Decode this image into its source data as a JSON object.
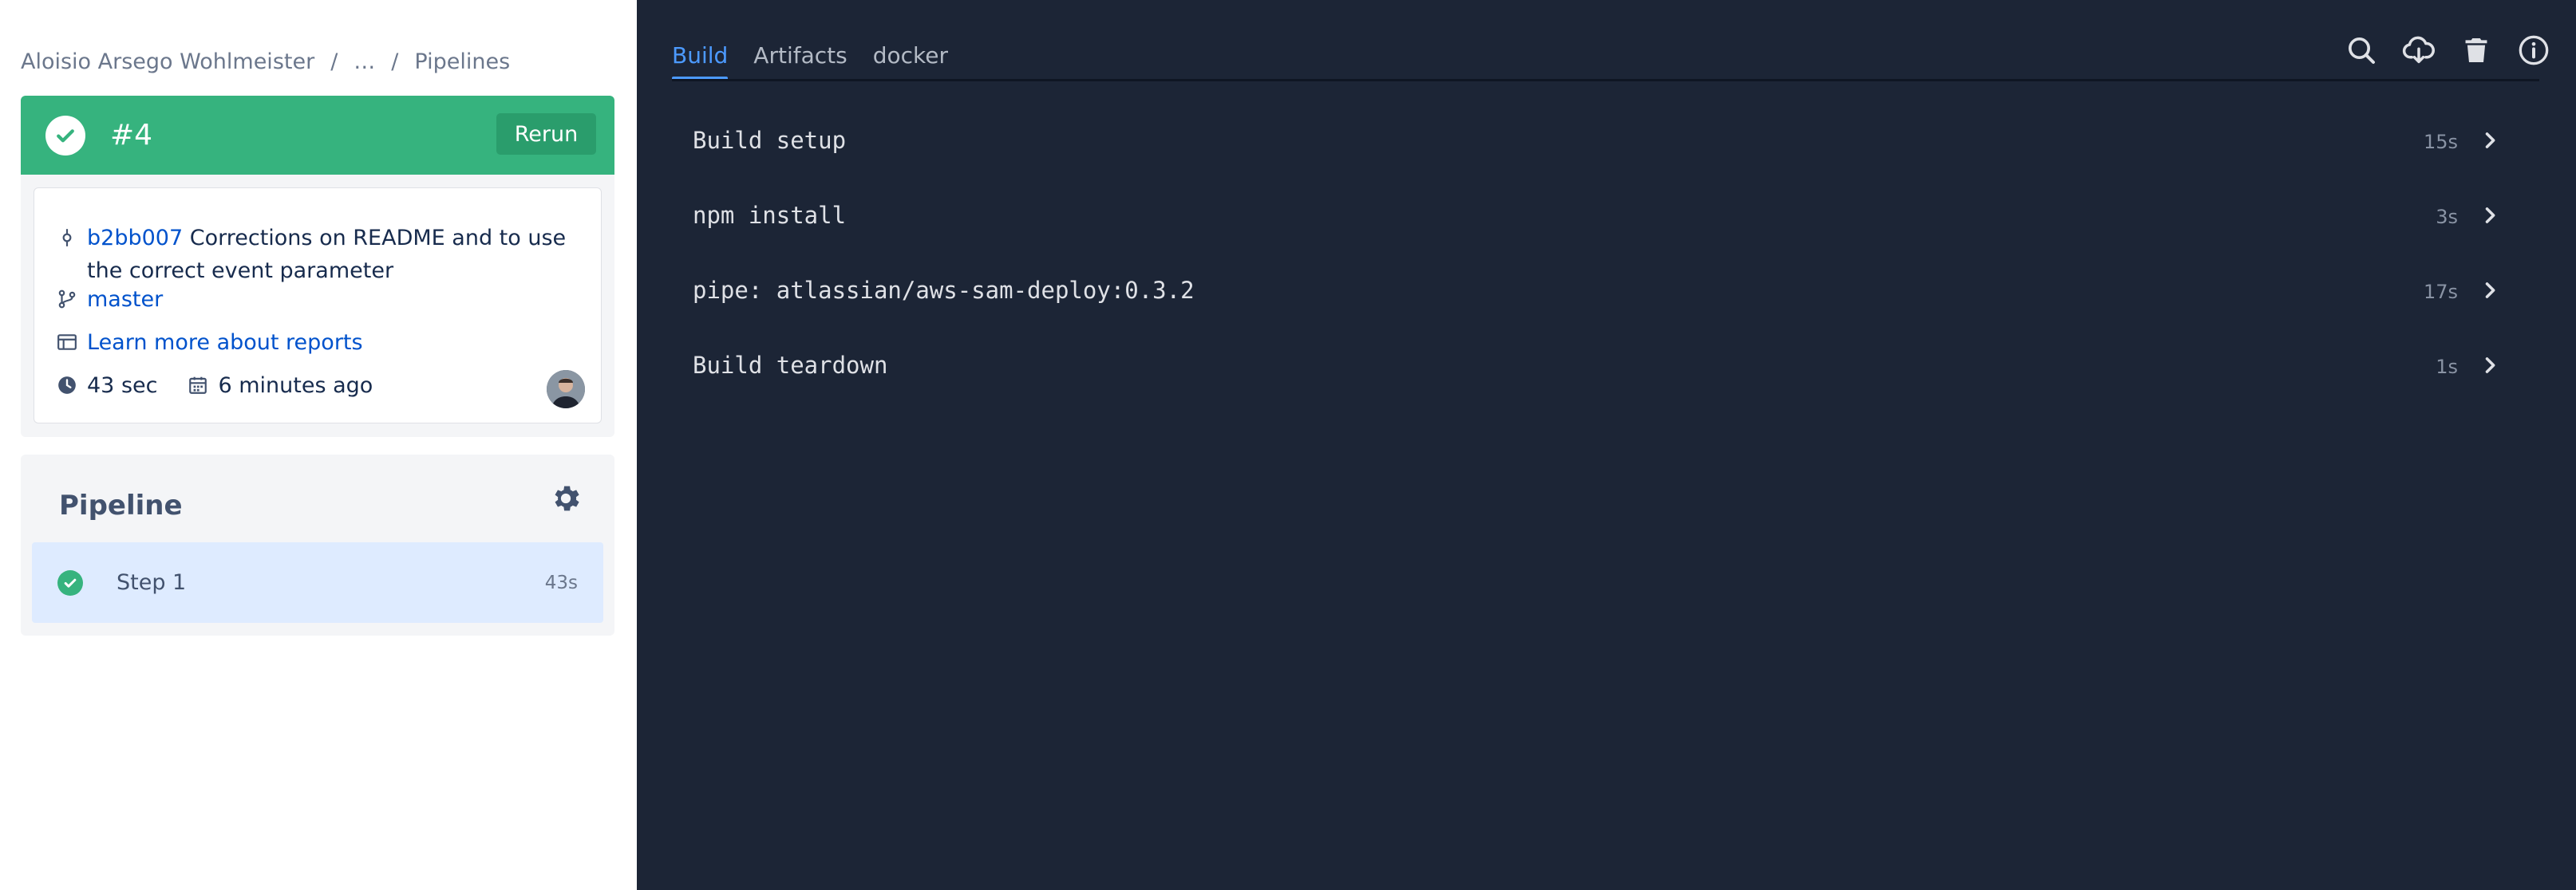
{
  "breadcrumb": {
    "items": [
      "Aloisio Arsego Wohlmeister",
      "…",
      "Pipelines"
    ],
    "separator": "/"
  },
  "build": {
    "number": "#4",
    "status": "successful",
    "status_color": "#36b37e",
    "rerun_label": "Rerun"
  },
  "commit": {
    "hash": "b2bb007",
    "message": "Corrections on README and to use the correct event parameter"
  },
  "branch": "master",
  "reports_link": "Learn more about reports",
  "duration": "43 sec",
  "time_ago": "6 minutes ago",
  "pipeline": {
    "title": "Pipeline",
    "steps": [
      {
        "label": "Step 1",
        "time": "43s",
        "status": "successful"
      }
    ]
  },
  "log_panel": {
    "tabs": [
      {
        "label": "Build",
        "active": true
      },
      {
        "label": "Artifacts",
        "active": false
      },
      {
        "label": "docker",
        "active": false
      }
    ],
    "toolbar": [
      "search-icon",
      "download-cloud-icon",
      "trash-icon",
      "info-icon"
    ],
    "steps": [
      {
        "name": "Build setup",
        "duration": "15s"
      },
      {
        "name": "npm install",
        "duration": "3s"
      },
      {
        "name": "pipe: atlassian/aws-sam-deploy:0.3.2",
        "duration": "17s"
      },
      {
        "name": "Build teardown",
        "duration": "1s"
      }
    ]
  },
  "colors": {
    "accent": "#4c9aff",
    "log_background": "#1c2536",
    "success": "#36b37e",
    "link": "#0052cc"
  }
}
